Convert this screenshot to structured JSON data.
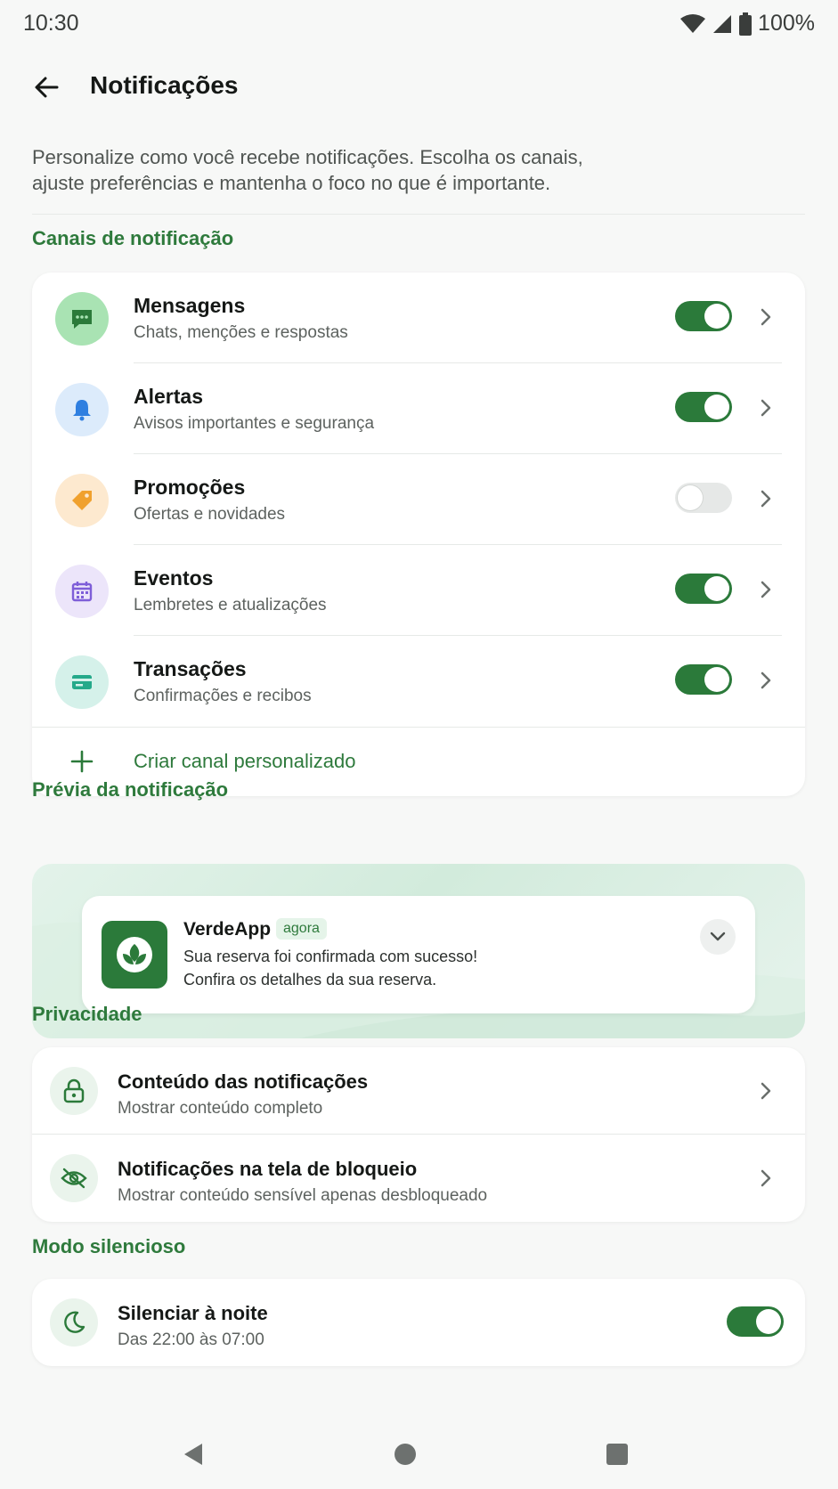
{
  "status_bar": {
    "time": "10:30",
    "battery": "100%"
  },
  "header": {
    "title": "Notificações"
  },
  "intro": {
    "line1": "Personalize como você recebe notificações. Escolha os canais,",
    "line2": "ajuste preferências e mantenha o foco no que é importante."
  },
  "channels": {
    "section_title": "Canais de notificação",
    "items": [
      {
        "title": "Mensagens",
        "subtitle": "Chats, menções e respostas",
        "enabled": true,
        "icon": "chat-icon",
        "icon_bg": "#a9e3b3",
        "icon_color": "#2b7a3a"
      },
      {
        "title": "Alertas",
        "subtitle": "Avisos importantes e segurança",
        "enabled": true,
        "icon": "bell-icon",
        "icon_bg": "#dcebfb",
        "icon_color": "#2f7fe0"
      },
      {
        "title": "Promoções",
        "subtitle": "Ofertas e novidades",
        "enabled": false,
        "icon": "tag-icon",
        "icon_bg": "#fde9cf",
        "icon_color": "#f0a12e"
      },
      {
        "title": "Eventos",
        "subtitle": "Lembretes e atualizações",
        "enabled": true,
        "icon": "calendar-icon",
        "icon_bg": "#ece5fa",
        "icon_color": "#7e5ed8"
      },
      {
        "title": "Transações",
        "subtitle": "Confirmações e recibos",
        "enabled": true,
        "icon": "card-icon",
        "icon_bg": "#d5f1ea",
        "icon_color": "#25a98a"
      }
    ],
    "create_label": "Criar canal personalizado"
  },
  "preview": {
    "section_title": "Prévia da notificação",
    "app_name": "VerdeApp",
    "time": "agora",
    "line1": "Sua reserva foi confirmada com sucesso!",
    "line2": "Confira os detalhes da sua reserva."
  },
  "privacy": {
    "section_title": "Privacidade",
    "items": [
      {
        "title": "Conteúdo das notificações",
        "subtitle": "Mostrar conteúdo completo",
        "icon": "lock-icon"
      },
      {
        "title": "Notificações na tela de bloqueio",
        "subtitle": "Mostrar conteúdo sensível apenas desbloqueado",
        "icon": "eye-off-icon"
      }
    ]
  },
  "silent_mode": {
    "section_title": "Modo silencioso",
    "title": "Silenciar à noite",
    "subtitle": "Das 22:00 às 07:00",
    "enabled": true,
    "icon": "moon-icon"
  },
  "colors": {
    "accent": "#2b7a3a",
    "section_title": "#2e7a3c",
    "background": "#f7f8f7"
  }
}
